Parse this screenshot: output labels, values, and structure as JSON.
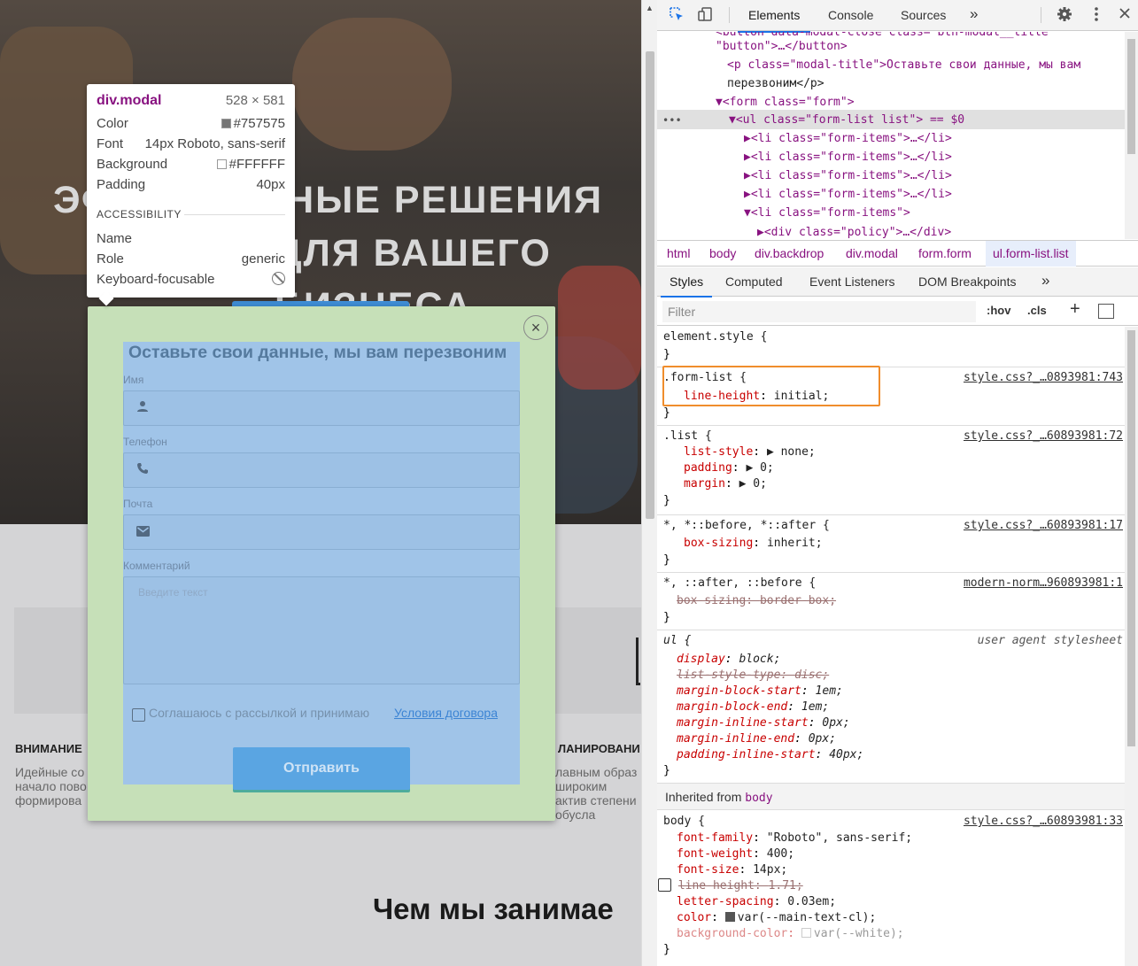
{
  "site": {
    "hero_title_line1": "ЭФФЕКТИВНЫЕ РЕШЕНИЯ",
    "hero_title_line2": "ДЛЯ ВАШЕГО БИЗНЕСА",
    "attention_heading": "ВНИМАНИЕ",
    "planning_heading": "ЛАНИРОВАНИ",
    "left_paragraph": "Идейные со начало пово формирова",
    "right_paragraph": "лавным образ широким актив степени обусла",
    "section_heading": "Чем мы занимае"
  },
  "modal": {
    "close_glyph": "×",
    "title": "Оставьте свои данные, мы вам перезвоним",
    "fields": [
      {
        "label": "Имя",
        "icon": "person-icon",
        "glyph": "👤"
      },
      {
        "label": "Телефон",
        "icon": "phone-icon",
        "glyph": "✆"
      },
      {
        "label": "Почта",
        "icon": "mail-icon",
        "glyph": "✉"
      }
    ],
    "comment_label": "Комментарий",
    "comment_placeholder": "Введите текст",
    "consent_text": "Соглашаюсь с рассылкой и принимаю",
    "consent_link": "Условия договора",
    "submit_label": "Отправить"
  },
  "inspect_tooltip": {
    "element": "div.modal",
    "size": "528 × 581",
    "rows": [
      {
        "label": "Color",
        "value": "#757575",
        "swatch": "#757575"
      },
      {
        "label": "Font",
        "value": "14px Roboto, sans-serif"
      },
      {
        "label": "Background",
        "value": "#FFFFFF",
        "swatch": "#FFFFFF"
      },
      {
        "label": "Padding",
        "value": "40px"
      }
    ],
    "accessibility_heading": "ACCESSIBILITY",
    "a11y": [
      {
        "label": "Name",
        "value": ""
      },
      {
        "label": "Role",
        "value": "generic"
      },
      {
        "label": "Keyboard-focusable",
        "value": ""
      }
    ]
  },
  "devtools": {
    "tabs": [
      "Elements",
      "Console",
      "Sources"
    ],
    "active_tab": "Elements",
    "more_tabs": "»",
    "tree": [
      {
        "text": "<button data-modal-close class=\"btn-modal__title\""
      },
      {
        "text": "\"button\">…</button>"
      },
      {
        "text": "<p class=\"modal-title\">Оставьте свои данные, мы вам"
      },
      {
        "text": "перезвоним</p>"
      },
      {
        "text": "▼<form class=\"form\">"
      },
      {
        "text": "▼<ul class=\"form-list list\"> == $0"
      },
      {
        "text": "▶<li class=\"form-items\">…</li>"
      },
      {
        "text": "▶<li class=\"form-items\">…</li>"
      },
      {
        "text": "▶<li class=\"form-items\">…</li>"
      },
      {
        "text": "▶<li class=\"form-items\">…</li>"
      },
      {
        "text": "▼<li class=\"form-items\">"
      },
      {
        "text": "▶<div class=\"policy\">…</div>"
      }
    ],
    "breadcrumbs": [
      "html",
      "body",
      "div.backdrop",
      "div.modal",
      "form.form",
      "ul.form-list.list"
    ],
    "styles_tabs": [
      "Styles",
      "Computed",
      "Event Listeners",
      "DOM Breakpoints"
    ],
    "styles_more": "»",
    "filter_placeholder": "Filter",
    "hov": ":hov",
    "cls": ".cls",
    "plus": "+",
    "rules": {
      "element_style": {
        "selector": "element.style {",
        "close": "}"
      },
      "form_list": {
        "selector": ".form-list {",
        "source": "style.css?_…0893981:743",
        "props": [
          {
            "name": "line-height",
            "value": "initial;"
          }
        ],
        "close": "}"
      },
      "list": {
        "selector": ".list {",
        "source": "style.css?_…60893981:72",
        "props": [
          {
            "name": "list-style",
            "value": "▶ none;"
          },
          {
            "name": "padding",
            "value": "▶ 0;"
          },
          {
            "name": "margin",
            "value": "▶ 0;"
          }
        ],
        "close": "}"
      },
      "universal": {
        "selector": "*, *::before, *::after {",
        "source": "style.css?_…60893981:17",
        "props": [
          {
            "name": "box-sizing",
            "value": "inherit;"
          }
        ],
        "close": "}"
      },
      "normalize": {
        "selector": "*, ::after, ::before {",
        "source": "modern-norm…960893981:1",
        "props": [
          {
            "name": "box-sizing",
            "value": "border-box;"
          }
        ],
        "close": "}"
      },
      "ua": {
        "selector": "ul {",
        "source": "user agent stylesheet",
        "props": [
          {
            "name": "display",
            "value": "block;"
          },
          {
            "name": "list-style-type",
            "value": "disc;"
          },
          {
            "name": "margin-block-start",
            "value": "1em;"
          },
          {
            "name": "margin-block-end",
            "value": "1em;"
          },
          {
            "name": "margin-inline-start",
            "value": "0px;"
          },
          {
            "name": "margin-inline-end",
            "value": "0px;"
          },
          {
            "name": "padding-inline-start",
            "value": "40px;"
          }
        ],
        "close": "}"
      },
      "inherited_label": "Inherited from",
      "inherited_element": "body",
      "body": {
        "selector": "body {",
        "source": "style.css?_…60893981:33",
        "props": [
          {
            "name": "font-family",
            "value": "\"Roboto\", sans-serif;"
          },
          {
            "name": "font-weight",
            "value": "400;"
          },
          {
            "name": "font-size",
            "value": "14px;"
          },
          {
            "name": "line-height",
            "value": "1.71;"
          },
          {
            "name": "letter-spacing",
            "value": "0.03em;"
          },
          {
            "name": "color",
            "value": "var(--main-text-cl);"
          },
          {
            "name": "background-color",
            "value": "var(--white);"
          }
        ],
        "close": "}"
      }
    }
  },
  "colors": {
    "modal_padding_overlay": "#c6e0b8",
    "modal_content_overlay": "#a0c4e8",
    "highlight_outline": "#f08d2c",
    "devtools_tag": "#881280",
    "devtools_attr": "#994500",
    "devtools_prop": "#c80000"
  }
}
